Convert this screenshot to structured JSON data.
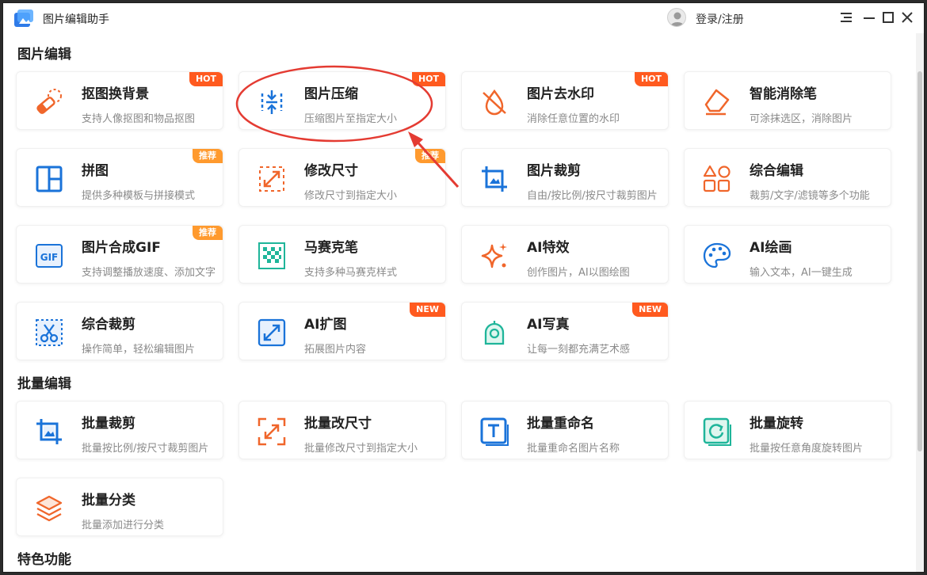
{
  "app": {
    "title": "图片编辑助手",
    "user_link": "登录/注册"
  },
  "sections": {
    "edit": "图片编辑",
    "batch": "批量编辑",
    "special": "特色功能"
  },
  "colors": {
    "brand_orange": "#ff5a1f",
    "recommend_orange": "#ff9a2e",
    "icon_blue": "#1a73d9",
    "icon_orange": "#f0662b",
    "icon_green": "#1fb59a"
  },
  "edit_cards": [
    {
      "title": "抠图换背景",
      "desc": "支持人像抠图和物品抠图",
      "badge": "HOT",
      "icon": "eraser-icon"
    },
    {
      "title": "图片压缩",
      "desc": "压缩图片至指定大小",
      "badge": "HOT",
      "icon": "compress-icon"
    },
    {
      "title": "图片去水印",
      "desc": "消除任意位置的水印",
      "badge": "HOT",
      "icon": "watermark-remove-icon"
    },
    {
      "title": "智能消除笔",
      "desc": "可涂抹选区，消除图片",
      "badge": "",
      "icon": "eraser-pen-icon"
    },
    {
      "title": "拼图",
      "desc": "提供多种模板与拼接模式",
      "badge": "推荐",
      "icon": "collage-icon"
    },
    {
      "title": "修改尺寸",
      "desc": "修改尺寸到指定大小",
      "badge": "推荐",
      "icon": "resize-icon"
    },
    {
      "title": "图片裁剪",
      "desc": "自由/按比例/按尺寸裁剪图片",
      "badge": "",
      "icon": "crop-icon"
    },
    {
      "title": "综合编辑",
      "desc": "裁剪/文字/滤镜等多个功能",
      "badge": "",
      "icon": "shapes-icon"
    },
    {
      "title": "图片合成GIF",
      "desc": "支持调整播放速度、添加文字",
      "badge": "推荐",
      "icon": "gif-icon"
    },
    {
      "title": "马赛克笔",
      "desc": "支持多种马赛克样式",
      "badge": "",
      "icon": "mosaic-icon"
    },
    {
      "title": "AI特效",
      "desc": "创作图片，AI以图绘图",
      "badge": "",
      "icon": "sparkle-icon"
    },
    {
      "title": "AI绘画",
      "desc": "输入文本，AI一键生成",
      "badge": "",
      "icon": "palette-icon"
    },
    {
      "title": "综合裁剪",
      "desc": "操作简单，轻松编辑图片",
      "badge": "",
      "icon": "scissors-icon"
    },
    {
      "title": "AI扩图",
      "desc": "拓展图片内容",
      "badge": "NEW",
      "icon": "expand-icon"
    },
    {
      "title": "AI写真",
      "desc": "让每一刻都充满艺术感",
      "badge": "NEW",
      "icon": "portrait-icon"
    }
  ],
  "batch_cards": [
    {
      "title": "批量裁剪",
      "desc": "批量按比例/按尺寸裁剪图片",
      "badge": "",
      "icon": "batch-crop-icon"
    },
    {
      "title": "批量改尺寸",
      "desc": "批量修改尺寸到指定大小",
      "badge": "",
      "icon": "batch-resize-icon"
    },
    {
      "title": "批量重命名",
      "desc": "批量重命名图片名称",
      "badge": "",
      "icon": "rename-icon"
    },
    {
      "title": "批量旋转",
      "desc": "批量按任意角度旋转图片",
      "badge": "",
      "icon": "rotate-icon"
    },
    {
      "title": "批量分类",
      "desc": "批量添加进行分类",
      "badge": "",
      "icon": "layers-icon"
    }
  ]
}
